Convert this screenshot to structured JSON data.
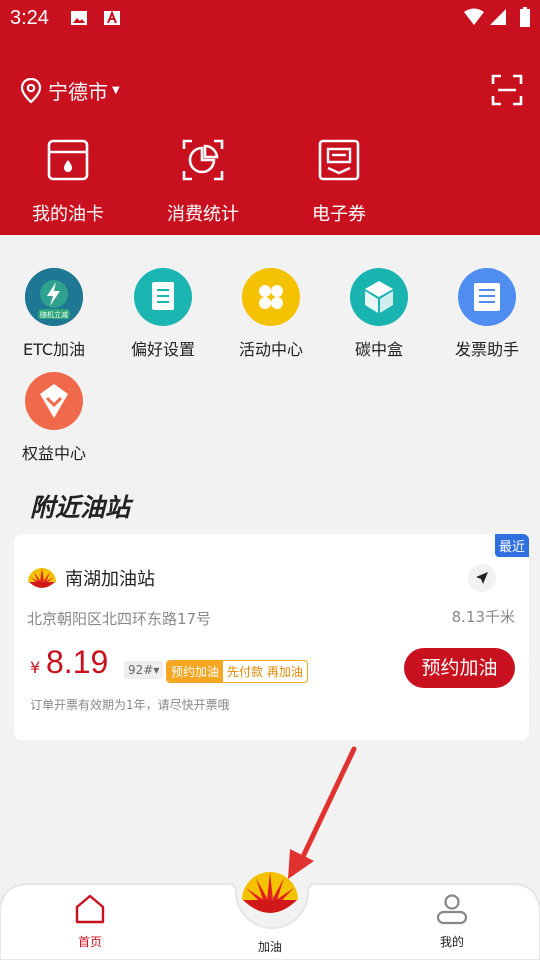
{
  "status_bar": {
    "time": "3:24",
    "icons": [
      "image-icon",
      "a-box-icon",
      "wifi-icon",
      "signal-icon",
      "battery-icon"
    ]
  },
  "header": {
    "city": "宁德市",
    "location_icon": "location-pin-icon",
    "scan_icon": "scan-icon"
  },
  "top_nav": [
    {
      "label": "我的油卡",
      "icon": "fuel-card-icon"
    },
    {
      "label": "消费统计",
      "icon": "pie-chart-icon"
    },
    {
      "label": "电子券",
      "icon": "coupon-icon"
    }
  ],
  "services": [
    {
      "label": "ETC加油",
      "icon": "etc-icon",
      "badge": "随机立减"
    },
    {
      "label": "偏好设置",
      "icon": "preference-icon"
    },
    {
      "label": "活动中心",
      "icon": "activity-icon"
    },
    {
      "label": "碳中盒",
      "icon": "carbon-box-icon"
    },
    {
      "label": "发票助手",
      "icon": "invoice-icon"
    },
    {
      "label": "权益中心",
      "icon": "benefits-icon"
    }
  ],
  "nearby": {
    "title": "附近油站",
    "station": {
      "recent_badge": "最近",
      "name": "南湖加油站",
      "address": "北京朝阳区北四环东路17号",
      "distance": "8.13千米",
      "currency": "¥",
      "price": "8.19",
      "grade": "92#▾",
      "promo_primary": "预约加油",
      "promo_secondary": "先付款 再加油",
      "book_button": "预约加油",
      "note": "订单开票有效期为1年，请尽快开票哦"
    }
  },
  "tabbar": {
    "home": "首页",
    "refuel": "加油",
    "mine": "我的"
  },
  "colors": {
    "brand_red": "#c8101e",
    "promo_orange": "#f5a623",
    "recent_blue": "#2f6fe0",
    "annotation_red": "#e0322f"
  }
}
